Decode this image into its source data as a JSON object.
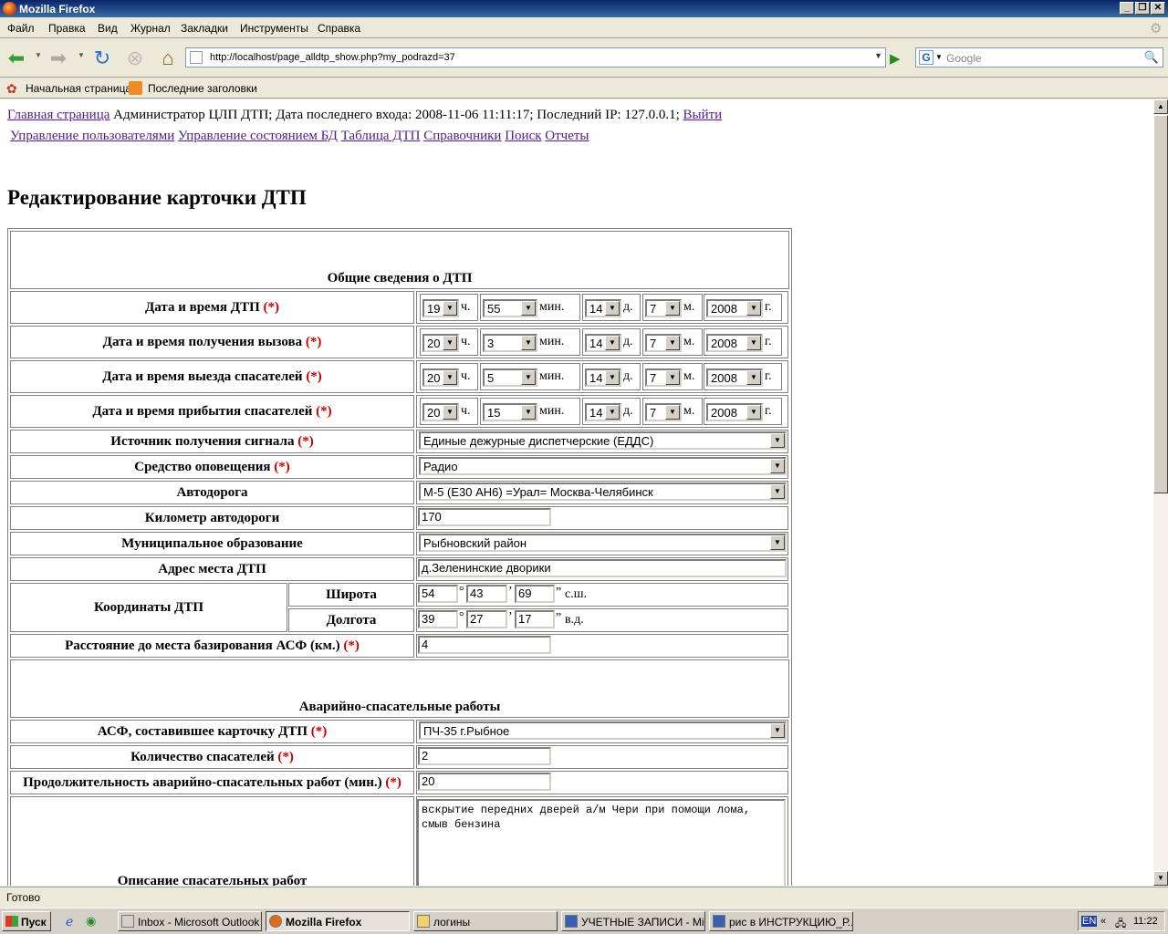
{
  "window": {
    "title": "Mozilla Firefox"
  },
  "menu": [
    "Файл",
    "Правка",
    "Вид",
    "Журнал",
    "Закладки",
    "Инструменты",
    "Справка"
  ],
  "nav": {
    "url": "http://localhost/page_alldtp_show.php?my_podrazd=37",
    "search_placeholder": "Google"
  },
  "bookmarks": [
    "Начальная страница",
    "Последние заголовки"
  ],
  "header": {
    "home_link": "Главная страница",
    "info": "Администратор ЦЛП ДТП; Дата последнего входа: 2008-11-06 11:11:17; Последний IP: 127.0.0.1;",
    "logout": "Выйти",
    "links": [
      "Управление пользователями",
      "Управление состоянием БД",
      "Таблица ДТП",
      "Справочники",
      "Поиск",
      "Отчеты"
    ]
  },
  "page_title": "Редактирование карточки ДТП",
  "form": {
    "section1": "Общие сведения о ДТП",
    "section2": "Аварийно-спасательные работы",
    "required_mark": "(*)",
    "units": {
      "hour": "ч.",
      "min": "мин.",
      "day": "д.",
      "month": "м.",
      "year": "г."
    },
    "datetime_rows": [
      {
        "label": "Дата и время ДТП",
        "hour": "19",
        "min": "55",
        "day": "14",
        "month": "7",
        "year": "2008"
      },
      {
        "label": "Дата и время получения вызова",
        "hour": "20",
        "min": "3",
        "day": "14",
        "month": "7",
        "year": "2008"
      },
      {
        "label": "Дата и время выезда спасателей",
        "hour": "20",
        "min": "5",
        "day": "14",
        "month": "7",
        "year": "2008"
      },
      {
        "label": "Дата и время прибытия спасателей",
        "hour": "20",
        "min": "15",
        "day": "14",
        "month": "7",
        "year": "2008"
      }
    ],
    "signal_source": {
      "label": "Источник получения сигнала",
      "value": "Единые дежурные диспетчерские (ЕДДС)"
    },
    "notify_means": {
      "label": "Средство оповещения",
      "value": "Радио"
    },
    "road": {
      "label": "Автодорога",
      "value": "М-5 (Е30 АН6) =Урал= Москва-Челябинск"
    },
    "road_km": {
      "label": "Километр автодороги",
      "value": "170"
    },
    "municipality": {
      "label": "Муниципальное образование",
      "value": "Рыбновский район"
    },
    "address": {
      "label": "Адрес места ДТП",
      "value": "д.Зеленинские дворики"
    },
    "coords": {
      "label": "Координаты ДТП",
      "lat": {
        "label": "Широта",
        "deg": "54",
        "min": "43",
        "sec": "69",
        "suffix": "с.ш."
      },
      "lon": {
        "label": "Долгота",
        "deg": "39",
        "min": "27",
        "sec": "17",
        "suffix": "в.д."
      }
    },
    "distance": {
      "label": "Расстояние до места базирования АСФ (км.)",
      "value": "4"
    },
    "asf": {
      "label": "АСФ, составившее карточку ДТП",
      "value": "ПЧ-35 г.Рыбное"
    },
    "rescuers": {
      "label": "Количество спасателей",
      "value": "2"
    },
    "duration": {
      "label": "Продолжительность аварийно-спасательных работ (мин.)",
      "value": "20"
    },
    "description": {
      "label": "Описание спасательных работ",
      "value": "вскрытие передних дверей а/м Чери при помощи лома, смыв бензина"
    }
  },
  "status": "Готово",
  "taskbar": {
    "start": "Пуск",
    "tasks": [
      "Inbox - Microsoft Outlook",
      "Mozilla Firefox",
      "логины",
      "УЧЕТНЫЕ ЗАПИСИ - Mi...",
      "рис в ИНСТРУКЦИЮ_Р..."
    ],
    "lang": "EN",
    "clock": "11:22"
  }
}
